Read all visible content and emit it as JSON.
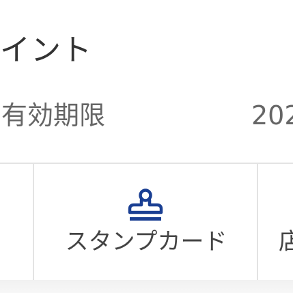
{
  "points": {
    "title": "イント"
  },
  "expiry": {
    "label": "有効期限",
    "value": "202"
  },
  "tabs": {
    "items": [
      {
        "label": "スタンプカード",
        "icon": "stamp-icon"
      },
      {
        "label": "店"
      }
    ]
  },
  "colors": {
    "accent": "#1a3f93",
    "text": "#333333",
    "subtext": "#666666",
    "divider": "#e3e3e3"
  }
}
